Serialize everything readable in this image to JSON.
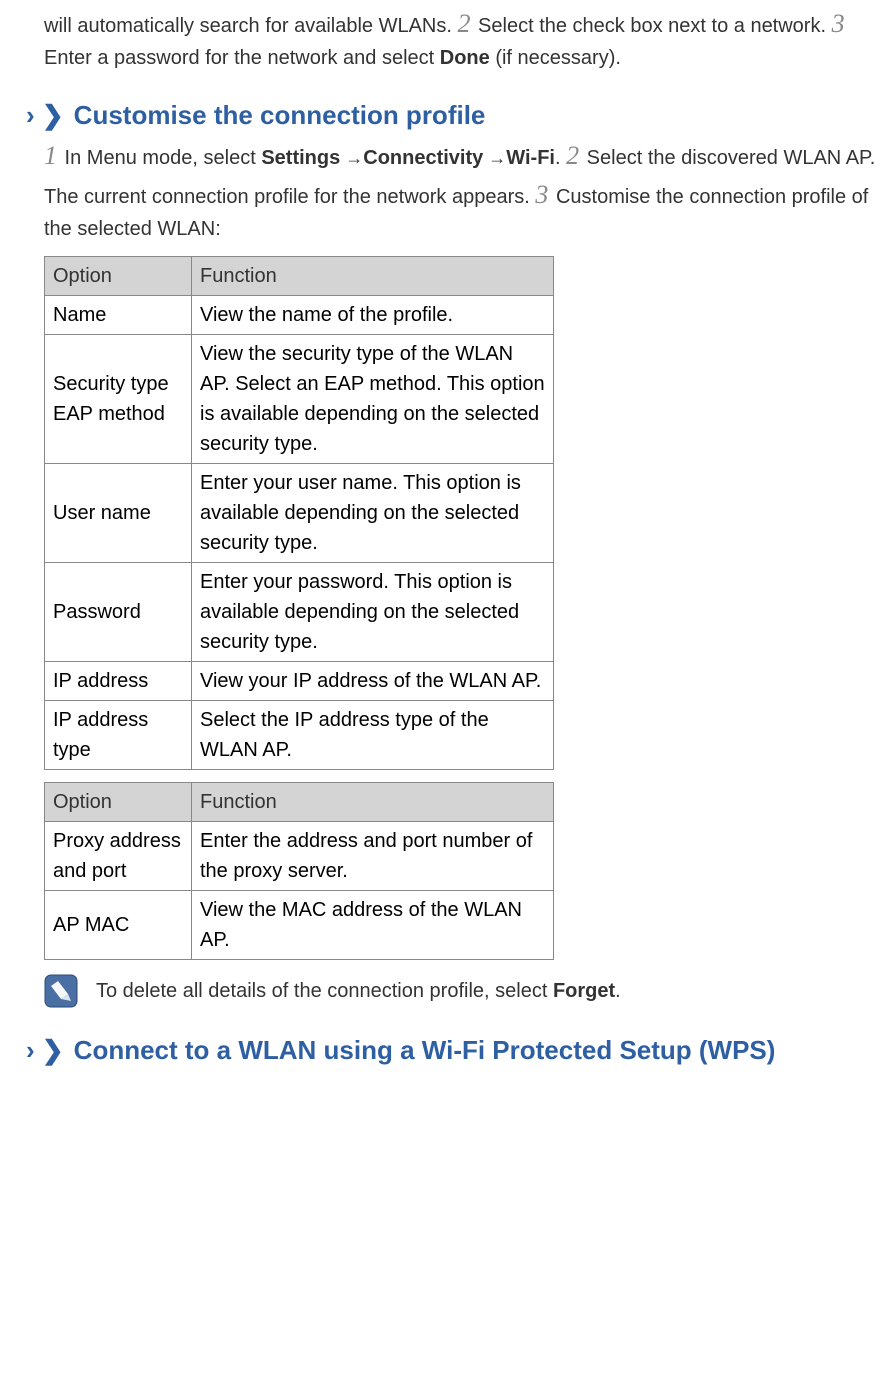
{
  "intro": {
    "part1": "will automatically search for available WLANs. ",
    "step2": "2",
    "part2": " Select the check box next to a network. ",
    "step3": "3",
    "part3": " Enter a password for the network and select ",
    "done": "Done",
    "part4": " (if necessary)."
  },
  "heading1": {
    "caret": "›  ❯",
    "title": "Customise the connection profile"
  },
  "h1body": {
    "s1": "1",
    "t1a": " In Menu mode, select ",
    "settings": "Settings",
    "arrow1": " →",
    "connectivity": "Connectivity",
    "arrow2": " →",
    "wifi": "Wi-Fi",
    "t1b": ". ",
    "s2": "2",
    "t2": " Select the discovered WLAN AP. The current connection profile for the network appears. ",
    "s3": "3",
    "t3": " Customise the connection profile of the selected WLAN:"
  },
  "table1": {
    "header": {
      "option": "Option",
      "function": "Function"
    },
    "rows": [
      {
        "opt": "Name",
        "fn": "View the name of the profile."
      },
      {
        "opt": "Security type EAP method",
        "fn": "View the security type of the WLAN AP. Select an EAP method. This option is available depending on the selected security type."
      },
      {
        "opt": "User name",
        "fn": "Enter your user name. This option is available depending on the selected security type."
      },
      {
        "opt": "Password",
        "fn": "Enter your password. This option is available depending on the selected security type."
      },
      {
        "opt": "IP address",
        "fn": "View your IP address of the WLAN AP."
      },
      {
        "opt": "IP address type",
        "fn": "Select the IP address type of the WLAN AP."
      }
    ]
  },
  "table2": {
    "header": {
      "option": "Option",
      "function": "Function"
    },
    "rows": [
      {
        "opt": "Proxy address and port",
        "fn": "Enter the address and port number of the proxy server."
      },
      {
        "opt": "AP MAC",
        "fn": "View the MAC address of the WLAN AP."
      }
    ]
  },
  "note": {
    "icon": "note-icon",
    "textA": "To delete all details of the connection profile, select ",
    "forget": "Forget",
    "textB": "."
  },
  "heading2": {
    "caret": "›  ❯",
    "title": "Connect to a WLAN using a Wi-Fi Protected Setup (WPS)"
  }
}
